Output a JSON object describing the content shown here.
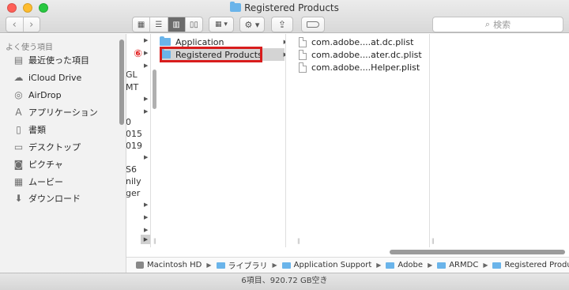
{
  "window": {
    "title": "Registered Products"
  },
  "toolbar": {
    "back_icon": "chevron-left",
    "forward_icon": "chevron-right",
    "view_modes": [
      "icon-view",
      "list-view",
      "column-view",
      "cover-flow-view"
    ],
    "active_view": "column-view",
    "arrange_icon": "grid-arrange",
    "action_icon": "gear",
    "share_icon": "share",
    "tag_icon": "tag",
    "search_placeholder": "検索"
  },
  "sidebar": {
    "heading": "よく使う項目",
    "items": [
      {
        "label": "最近使った項目",
        "icon": "recents-icon"
      },
      {
        "label": "iCloud Drive",
        "icon": "cloud-icon"
      },
      {
        "label": "AirDrop",
        "icon": "airdrop-icon"
      },
      {
        "label": "アプリケーション",
        "icon": "applications-icon"
      },
      {
        "label": "書類",
        "icon": "documents-icon"
      },
      {
        "label": "デスクトップ",
        "icon": "desktop-icon"
      },
      {
        "label": "ピクチャ",
        "icon": "camera-icon"
      },
      {
        "label": "ムービー",
        "icon": "movies-icon"
      },
      {
        "label": "ダウンロード",
        "icon": "downloads-icon"
      }
    ]
  },
  "columns": {
    "clipped_column_text": [
      "GL",
      "MT",
      "0",
      "015",
      "019",
      "S6",
      "nily",
      "ger"
    ],
    "folders": [
      {
        "label": "Application"
      },
      {
        "label": "Registered Products"
      }
    ],
    "step_marker": "⑥",
    "files": [
      {
        "label": "com.adobe....at.dc.plist"
      },
      {
        "label": "com.adobe....ater.dc.plist"
      },
      {
        "label": "com.adobe....Helper.plist"
      }
    ]
  },
  "pathbar": {
    "crumbs": [
      {
        "label": "Macintosh HD",
        "icon": "harddrive-icon"
      },
      {
        "label": "ライブラリ",
        "icon": "folder-icon"
      },
      {
        "label": "Application Support",
        "icon": "folder-icon"
      },
      {
        "label": "Adobe",
        "icon": "folder-icon"
      },
      {
        "label": "ARMDC",
        "icon": "folder-icon"
      },
      {
        "label": "Registered Products",
        "icon": "folder-icon"
      }
    ]
  },
  "status": {
    "text": "6項目、920.72 GB空き"
  },
  "colors": {
    "folder": "#6ab4ea",
    "highlight": "#d81d1d",
    "selected_row": "#d4d4d4"
  }
}
